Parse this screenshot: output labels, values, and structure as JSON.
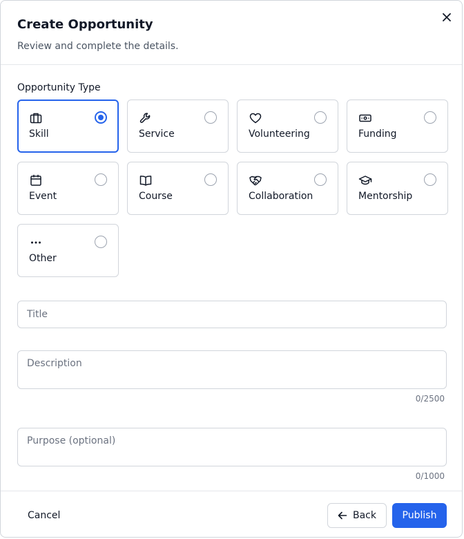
{
  "dialog": {
    "title": "Create Opportunity",
    "subtitle": "Review and complete the details."
  },
  "type_section": {
    "label": "Opportunity Type",
    "selected": "Skill",
    "options": [
      {
        "label": "Skill",
        "icon": "briefcase-icon",
        "selected": true
      },
      {
        "label": "Service",
        "icon": "wrench-icon",
        "selected": false
      },
      {
        "label": "Volunteering",
        "icon": "heart-icon",
        "selected": false
      },
      {
        "label": "Funding",
        "icon": "banknote-icon",
        "selected": false
      },
      {
        "label": "Event",
        "icon": "calendar-icon",
        "selected": false
      },
      {
        "label": "Course",
        "icon": "book-open-icon",
        "selected": false
      },
      {
        "label": "Collaboration",
        "icon": "handshake-icon",
        "selected": false
      },
      {
        "label": "Mentorship",
        "icon": "graduation-cap-icon",
        "selected": false
      },
      {
        "label": "Other",
        "icon": "ellipsis-icon",
        "selected": false
      }
    ]
  },
  "form": {
    "title_placeholder": "Title",
    "title_value": "",
    "description_placeholder": "Description",
    "description_value": "",
    "description_counter": "0/2500",
    "purpose_placeholder": "Purpose (optional)",
    "purpose_value": "",
    "purpose_counter": "0/1000"
  },
  "footer": {
    "cancel_label": "Cancel",
    "back_label": "Back",
    "publish_label": "Publish"
  },
  "colors": {
    "accent": "#2563eb",
    "border": "#d1d5db",
    "text": "#111827",
    "muted": "#6b7280"
  }
}
